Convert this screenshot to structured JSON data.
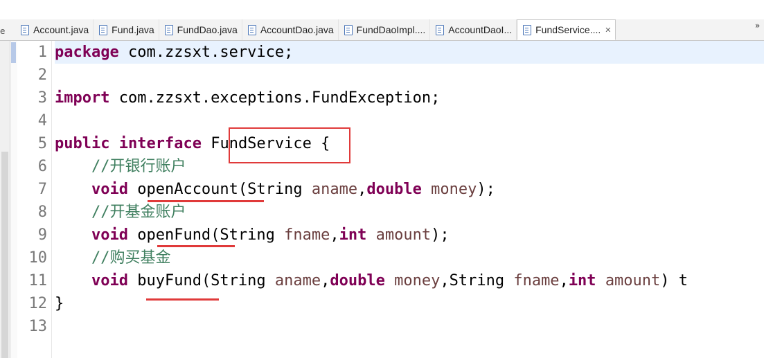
{
  "tabs": [
    {
      "label": "Account.java",
      "active": false
    },
    {
      "label": "Fund.java",
      "active": false
    },
    {
      "label": "FundDao.java",
      "active": false
    },
    {
      "label": "AccountDao.java",
      "active": false
    },
    {
      "label": "FundDaoImpl....",
      "active": false
    },
    {
      "label": "AccountDaoI...",
      "active": false
    },
    {
      "label": "FundService....",
      "active": true
    }
  ],
  "tab_close_glyph": "✕",
  "tab_overflow_glyph": "»",
  "tab_left_stub": "e",
  "editor": {
    "current_line": 1,
    "line_numbers": [
      "1",
      "2",
      "3",
      "4",
      "5",
      "6",
      "7",
      "8",
      "9",
      "10",
      "11",
      "12",
      "13"
    ],
    "lines": {
      "l1": {
        "kw": "package",
        "rest": " com.zzsxt.service;"
      },
      "l3": {
        "kw": "import",
        "rest": " com.zzsxt.exceptions.FundException;"
      },
      "l5": {
        "kw1": "public",
        "kw2": "interface",
        "name": "FundService",
        "brace": " {"
      },
      "l6": {
        "comment": "//开银行账户"
      },
      "l7": {
        "kw": "void",
        "method": "openAccount",
        "open": "(String ",
        "p1": "aname",
        "sep": ",",
        "kw2": "double",
        "p2": "money",
        "close": ");"
      },
      "l8": {
        "comment": "//开基金账户"
      },
      "l9": {
        "kw": "void",
        "method": "openFund",
        "open": "(String ",
        "p1": "fname",
        "sep": ",",
        "kw2": "int",
        "p2": "amount",
        "close": ");"
      },
      "l10": {
        "comment": "//购买基金"
      },
      "l11": {
        "kw": "void",
        "method": "buyFund",
        "open": "(String ",
        "p1": "aname",
        "sep1": ",",
        "kw2": "double",
        "p2": "money",
        "mid": ",String ",
        "p3": "fname",
        "sep2": ",",
        "kw3": "int",
        "p4": "amount",
        "close": ") t"
      },
      "l12": {
        "brace": "}"
      }
    }
  },
  "colors": {
    "keyword": "#7f0055",
    "comment": "#3f7f5f",
    "parameter": "#6a3e3e",
    "annotation": "#e03a3a",
    "current_line": "#e8f2fe"
  }
}
